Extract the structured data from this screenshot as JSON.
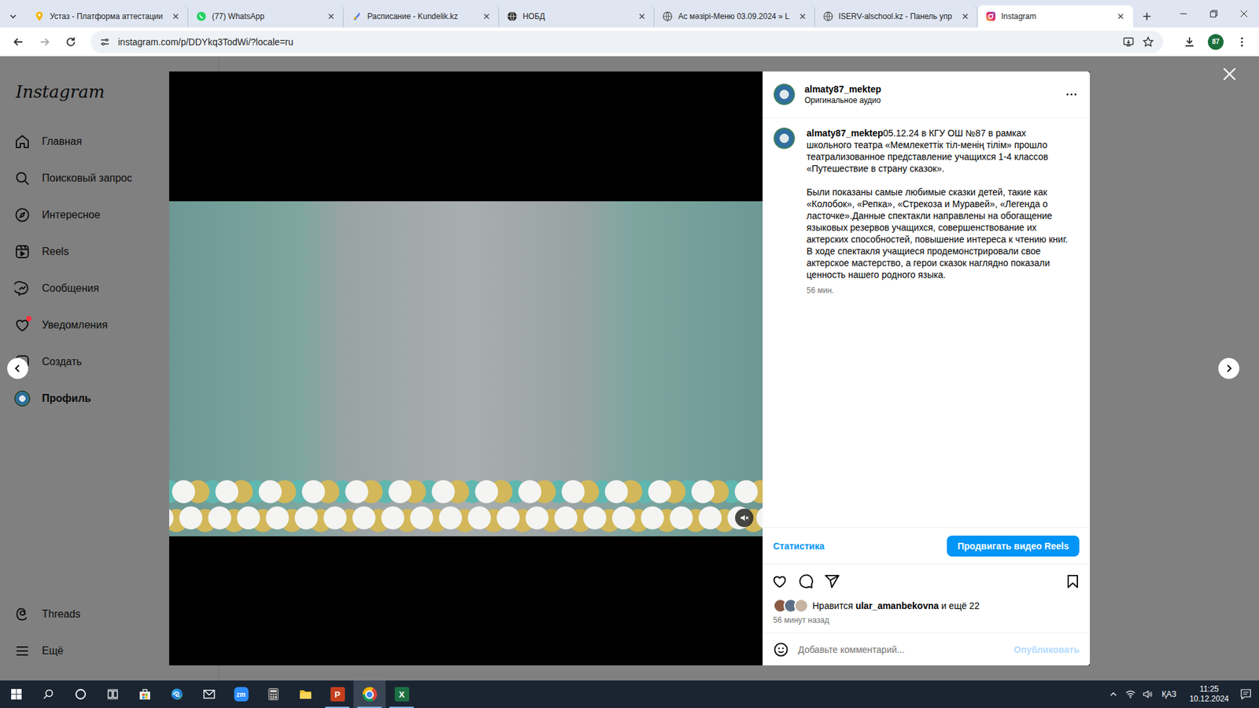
{
  "browser": {
    "tabs": [
      {
        "label": "Устаз - Платформа аттестации",
        "selected": false
      },
      {
        "label": "(77) WhatsApp",
        "selected": false
      },
      {
        "label": "Расписание - Kundelik.kz",
        "selected": false
      },
      {
        "label": "НОБД",
        "selected": false
      },
      {
        "label": "Ас мәзірі-Меню 03.09.2024 » L",
        "selected": false
      },
      {
        "label": "ISERV-alschool.kz - Панель упр",
        "selected": false
      },
      {
        "label": "Instagram",
        "selected": true
      }
    ],
    "url": "instagram.com/p/DDYkq3TodWi/?locale=ru",
    "profile_badge": "87"
  },
  "sidebar": {
    "logo": "Instagram",
    "items": [
      {
        "label": "Главная",
        "kind": "icon",
        "selected": false,
        "badge": false
      },
      {
        "label": "Поисковый запрос",
        "kind": "icon",
        "selected": false,
        "badge": false
      },
      {
        "label": "Интересное",
        "kind": "icon",
        "selected": false,
        "badge": false
      },
      {
        "label": "Reels",
        "kind": "icon",
        "selected": false,
        "badge": false
      },
      {
        "label": "Сообщения",
        "kind": "icon",
        "selected": false,
        "badge": false
      },
      {
        "label": "Уведомления",
        "kind": "icon",
        "selected": false,
        "badge": true
      },
      {
        "label": "Создать",
        "kind": "icon",
        "selected": false,
        "badge": false
      },
      {
        "label": "Профиль",
        "kind": "avatar",
        "selected": true,
        "badge": false
      }
    ],
    "bottom_items": [
      {
        "label": "Threads"
      },
      {
        "label": "Ещё"
      }
    ]
  },
  "post": {
    "author": "almaty87_mektep",
    "audio": "Оригинальное аудио",
    "caption": [
      "05.12.24 в КГУ ОШ №87 в рамках школьного театра «Мемлекеттік тіл-менің тілім» прошло театрализованное представление учащихся 1-4 классов «Путешествие в страну сказок».",
      "Были показаны самые любимые сказки детей, такие как «Колобок», «Репка», «Стрекоза и Муравей», «Легенда о ласточке».Данные спектакли направлены на обогащение языковых резервов учащихся, совершенствование их актерских способностей, повышение интереса к чтению книг. В ходе спектакля учащиеся продемонстрировали свое актерское мастерство, а герои сказок наглядно показали ценность нашего родного языка."
    ],
    "age": "56 мин.",
    "stats_link": "Статистика",
    "promote_button": "Продвигать видео Reels",
    "muted": true,
    "liked": false,
    "saved": false,
    "likes_prefix": "Нравится",
    "liked_by": "ular_amanbekovna",
    "likes_suffix": "и ещё 22",
    "time": "56 минут назад",
    "comment_placeholder": "Добавьте комментарий...",
    "publish_button": "Опубликовать",
    "publish_disabled": true
  },
  "taskbar": {
    "apps": [
      {
        "kind": "start",
        "label": "",
        "running": false,
        "active": false
      },
      {
        "kind": "search",
        "label": "",
        "running": false,
        "active": false
      },
      {
        "kind": "cortana",
        "label": "",
        "running": false,
        "active": false
      },
      {
        "kind": "task-view",
        "label": "",
        "running": false,
        "active": false
      },
      {
        "kind": "store",
        "label": "",
        "running": false,
        "active": false
      },
      {
        "kind": "edge",
        "label": "",
        "running": false,
        "active": false
      },
      {
        "kind": "mail",
        "label": "",
        "running": false,
        "active": false
      },
      {
        "kind": "zoom",
        "label": "zm",
        "running": false,
        "active": false
      },
      {
        "kind": "calculator",
        "label": "",
        "running": false,
        "active": false
      },
      {
        "kind": "explorer",
        "label": "",
        "running": false,
        "active": false
      },
      {
        "kind": "powerpoint",
        "label": "P",
        "running": true,
        "active": false
      },
      {
        "kind": "chrome",
        "label": "",
        "running": true,
        "active": true
      },
      {
        "kind": "excel",
        "label": "X",
        "running": true,
        "active": false
      }
    ],
    "language": "ҚАЗ",
    "time": "11:25",
    "date": "10.12.2024"
  }
}
